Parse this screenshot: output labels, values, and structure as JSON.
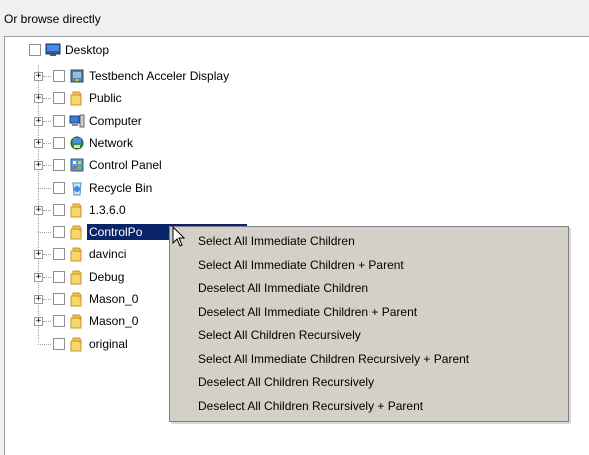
{
  "header": {
    "label": "Or browse directly"
  },
  "tree": {
    "root": {
      "label": "Desktop",
      "icon": "desktop-icon"
    },
    "items": [
      {
        "label": "Testbench Acceler Display",
        "icon": "app-icon",
        "expandable": true
      },
      {
        "label": "Public",
        "icon": "folder-icon",
        "expandable": true
      },
      {
        "label": "Computer",
        "icon": "computer-icon",
        "expandable": true
      },
      {
        "label": "Network",
        "icon": "network-icon",
        "expandable": true
      },
      {
        "label": "Control Panel",
        "icon": "control-panel-icon",
        "expandable": true
      },
      {
        "label": "Recycle Bin",
        "icon": "recycle-bin-icon",
        "expandable": false
      },
      {
        "label": "1.3.6.0",
        "icon": "folder-icon",
        "expandable": true
      },
      {
        "label": "ControlPo",
        "icon": "folder-icon",
        "expandable": false,
        "selected": true
      },
      {
        "label": "davinci",
        "icon": "folder-icon",
        "expandable": true
      },
      {
        "label": "Debug",
        "icon": "folder-icon",
        "expandable": true
      },
      {
        "label": "Mason_0",
        "icon": "folder-icon",
        "expandable": true
      },
      {
        "label": "Mason_0",
        "icon": "folder-icon",
        "expandable": true
      },
      {
        "label": "original",
        "icon": "folder-icon",
        "expandable": false
      }
    ]
  },
  "context_menu": {
    "items": [
      "Select All Immediate Children",
      "Select All Immediate Children + Parent",
      "Deselect All Immediate Children",
      "Deselect All Immediate Children + Parent",
      "Select All Children Recursively",
      "Select All Immediate Children Recursively + Parent",
      "Deselect All Children Recursively",
      "Deselect All Children Recursively + Parent"
    ]
  },
  "colors": {
    "selection_bg": "#0a246a",
    "menu_bg": "#d4d0c8",
    "folder": "#f4c542"
  }
}
